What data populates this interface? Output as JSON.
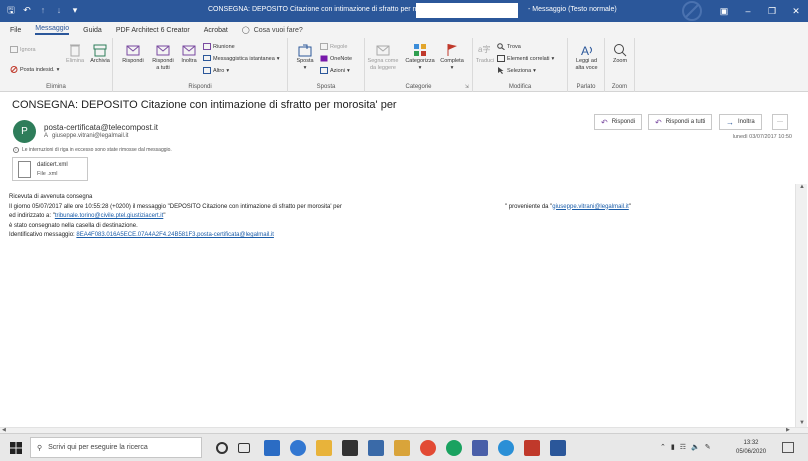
{
  "window": {
    "title": "CONSEGNA: DEPOSITO Citazione con intimazione di sfratto per morosita' per",
    "title_suffix": "- Messaggio (Testo normale)"
  },
  "tabs": {
    "file": "File",
    "messaggio": "Messaggio",
    "guida": "Guida",
    "pdf": "PDF Architect 6 Creator",
    "acrobat": "Acrobat",
    "tell_me": "Cosa vuoi fare?"
  },
  "ribbon": {
    "elimina": {
      "ignora": "Ignora",
      "posta_indesiderata": "Posta indesid.",
      "elimina": "Elimina",
      "archivia": "Archivia",
      "label": "Elimina"
    },
    "rispondi": {
      "rispondi": "Rispondi",
      "rispondi_a_tutti_1": "Rispondi",
      "rispondi_a_tutti_2": "a tutti",
      "inoltra": "Inoltra",
      "riunione": "Riunione",
      "messaggistica": "Messaggistica istantanea",
      "altro": "Altro",
      "label": "Rispondi"
    },
    "sposta": {
      "sposta": "Sposta",
      "regole": "Regole",
      "onenote": "OneNote",
      "azioni": "Azioni",
      "label": "Sposta"
    },
    "categorie": {
      "segna_come_1": "Segna come",
      "segna_come_2": "da leggere",
      "categorizza": "Categorizza",
      "completa": "Completa",
      "label": "Categorie"
    },
    "modifica": {
      "traduci": "Traduci",
      "trova": "Trova",
      "elementi_correlati": "Elementi correlati",
      "seleziona": "Seleziona",
      "label": "Modifica"
    },
    "parlato": {
      "leggi_1": "Leggi ad",
      "leggi_2": "alta voce",
      "label": "Parlato"
    },
    "zoom": {
      "zoom": "Zoom",
      "label": "Zoom"
    }
  },
  "message": {
    "subject": "CONSEGNA: DEPOSITO Citazione con intimazione di sfratto per morosita' per",
    "avatar_letter": "P",
    "sender": "posta-certificata@telecompost.it",
    "to_label": "A",
    "to_address": "giuseppe.vitrani@legalmail.it",
    "info": "Le interruzioni di riga in eccesso sono state rimosse dal messaggio.",
    "date": "lunedì 03/07/2017 10:50",
    "actions": {
      "rispondi": "Rispondi",
      "rispondi_a_tutti": "Rispondi a tutti",
      "inoltra": "Inoltra",
      "more": "···"
    },
    "attachment": {
      "name": "daticert.xml",
      "type": "File .xml"
    },
    "body": {
      "line1": "Ricevuta di avvenuta consegna",
      "line2_a": "Il giorno 05/07/2017 alle ore 10:55:28 (+0200) il messaggio \"DEPOSITO Citazione con intimazione di sfratto per morosita' per",
      "line2_b": "\" proveniente da \"",
      "line2_link": "giuseppe.vitrani@legalmail.it",
      "line2_end": "\"",
      "line3_a": "ed indirizzato a: \"",
      "line3_link": "tribunale.torino@civile.ptel.giustiziacert.it",
      "line3_end": "\"",
      "line4": "è stato consegnato nella casella di destinazione.",
      "line5_a": "Identificativo messaggio: ",
      "line5_link": "8EA4F083.016A5ECE.07A4A2F4.24B581F3.posta-certificata@legalmail.it"
    }
  },
  "taskbar": {
    "search_placeholder": "Scrivi qui per eseguire la ricerca",
    "time": "13:32",
    "date": "05/06/2020"
  },
  "colors": {
    "titlebar": "#2b579a",
    "accent": "#2b579a",
    "link": "#1a5ca8",
    "avatar": "#2e7d5a"
  }
}
